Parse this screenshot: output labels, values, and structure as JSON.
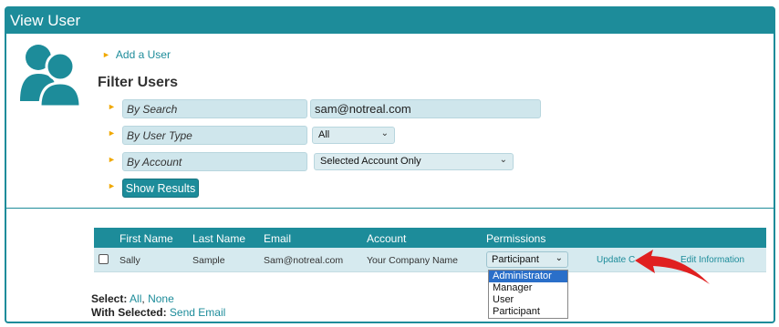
{
  "window": {
    "title": "View User"
  },
  "links": {
    "add_user": "Add a User"
  },
  "filter": {
    "title": "Filter Users",
    "search_label": "By Search",
    "search_value": "sam@notreal.com",
    "user_type_label": "By User Type",
    "user_type_value": "All",
    "account_label": "By Account",
    "account_value": "Selected Account Only",
    "show_button": "Show Results"
  },
  "table": {
    "headers": [
      "First Name",
      "Last Name",
      "Email",
      "Account",
      "Permissions"
    ],
    "rows": [
      {
        "first": "Sally",
        "last": "Sample",
        "email": "Sam@notreal.com",
        "account": "Your Company Name",
        "permission": "Participant",
        "update_link": "Update C",
        "edit_link": "Edit Information"
      }
    ]
  },
  "permissions_dropdown": {
    "options": [
      "Administrator",
      "Manager",
      "User",
      "Participant"
    ],
    "highlighted": "Administrator"
  },
  "bottom": {
    "select_label": "Select:",
    "select_all": "All",
    "select_none": "None",
    "with_selected_label": "With Selected:",
    "send_email": "Send Email"
  },
  "colors": {
    "accent": "#1d8c9a",
    "arrow_bullet": "#f0a800",
    "annotation": "#e02020",
    "highlight": "#2a6fc9"
  },
  "icons": [
    "users-icon",
    "chevron-down-icon",
    "red-arrow-annotation"
  ]
}
